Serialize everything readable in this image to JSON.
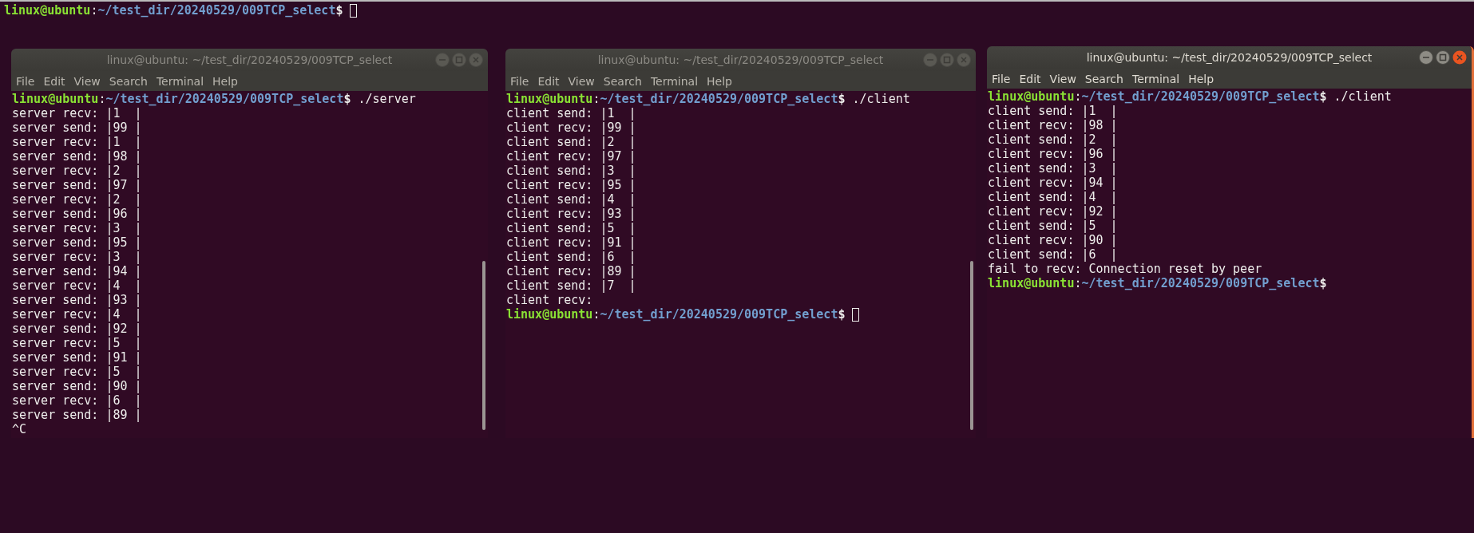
{
  "desktop_prompt": {
    "user": "linux@ubuntu",
    "separator": ":",
    "path": "~/test_dir/20240529/009TCP_select",
    "symbol": "$",
    "cursor": true
  },
  "windows": [
    {
      "title": "linux@ubuntu: ~/test_dir/20240529/009TCP_select",
      "focused": false,
      "menu": [
        "File",
        "Edit",
        "View",
        "Search",
        "Terminal",
        "Help"
      ],
      "lines": [
        {
          "kind": "prompt",
          "user": "linux@ubuntu",
          "separator": ":",
          "path": "~/test_dir/20240529/009TCP_select",
          "symbol": "$",
          "command": " ./server"
        },
        {
          "kind": "output",
          "text": "server recv: |1  |"
        },
        {
          "kind": "output",
          "text": "server send: |99 |"
        },
        {
          "kind": "output",
          "text": "server recv: |1  |"
        },
        {
          "kind": "output",
          "text": "server send: |98 |"
        },
        {
          "kind": "output",
          "text": "server recv: |2  |"
        },
        {
          "kind": "output",
          "text": "server send: |97 |"
        },
        {
          "kind": "output",
          "text": "server recv: |2  |"
        },
        {
          "kind": "output",
          "text": "server send: |96 |"
        },
        {
          "kind": "output",
          "text": "server recv: |3  |"
        },
        {
          "kind": "output",
          "text": "server send: |95 |"
        },
        {
          "kind": "output",
          "text": "server recv: |3  |"
        },
        {
          "kind": "output",
          "text": "server send: |94 |"
        },
        {
          "kind": "output",
          "text": "server recv: |4  |"
        },
        {
          "kind": "output",
          "text": "server send: |93 |"
        },
        {
          "kind": "output",
          "text": "server recv: |4  |"
        },
        {
          "kind": "output",
          "text": "server send: |92 |"
        },
        {
          "kind": "output",
          "text": "server recv: |5  |"
        },
        {
          "kind": "output",
          "text": "server send: |91 |"
        },
        {
          "kind": "output",
          "text": "server recv: |5  |"
        },
        {
          "kind": "output",
          "text": "server send: |90 |"
        },
        {
          "kind": "output",
          "text": "server recv: |6  |"
        },
        {
          "kind": "output",
          "text": "server send: |89 |"
        },
        {
          "kind": "output",
          "text": "^C"
        }
      ]
    },
    {
      "title": "linux@ubuntu: ~/test_dir/20240529/009TCP_select",
      "focused": false,
      "menu": [
        "File",
        "Edit",
        "View",
        "Search",
        "Terminal",
        "Help"
      ],
      "lines": [
        {
          "kind": "prompt",
          "user": "linux@ubuntu",
          "separator": ":",
          "path": "~/test_dir/20240529/009TCP_select",
          "symbol": "$",
          "command": " ./client"
        },
        {
          "kind": "output",
          "text": "client send: |1  |"
        },
        {
          "kind": "output",
          "text": "client recv: |99 |"
        },
        {
          "kind": "output",
          "text": "client send: |2  |"
        },
        {
          "kind": "output",
          "text": "client recv: |97 |"
        },
        {
          "kind": "output",
          "text": "client send: |3  |"
        },
        {
          "kind": "output",
          "text": "client recv: |95 |"
        },
        {
          "kind": "output",
          "text": "client send: |4  |"
        },
        {
          "kind": "output",
          "text": "client recv: |93 |"
        },
        {
          "kind": "output",
          "text": "client send: |5  |"
        },
        {
          "kind": "output",
          "text": "client recv: |91 |"
        },
        {
          "kind": "output",
          "text": "client send: |6  |"
        },
        {
          "kind": "output",
          "text": "client recv: |89 |"
        },
        {
          "kind": "output",
          "text": "client send: |7  |"
        },
        {
          "kind": "output",
          "text": "client recv:"
        },
        {
          "kind": "prompt",
          "user": "linux@ubuntu",
          "separator": ":",
          "path": "~/test_dir/20240529/009TCP_select",
          "symbol": "$",
          "cursor": true
        }
      ]
    },
    {
      "title": "linux@ubuntu: ~/test_dir/20240529/009TCP_select",
      "focused": true,
      "menu": [
        "File",
        "Edit",
        "View",
        "Search",
        "Terminal",
        "Help"
      ],
      "lines": [
        {
          "kind": "prompt",
          "user": "linux@ubuntu",
          "separator": ":",
          "path": "~/test_dir/20240529/009TCP_select",
          "symbol": "$",
          "command": " ./client"
        },
        {
          "kind": "output",
          "text": "client send: |1  |"
        },
        {
          "kind": "output",
          "text": "client recv: |98 |"
        },
        {
          "kind": "output",
          "text": "client send: |2  |"
        },
        {
          "kind": "output",
          "text": "client recv: |96 |"
        },
        {
          "kind": "output",
          "text": "client send: |3  |"
        },
        {
          "kind": "output",
          "text": "client recv: |94 |"
        },
        {
          "kind": "output",
          "text": "client send: |4  |"
        },
        {
          "kind": "output",
          "text": "client recv: |92 |"
        },
        {
          "kind": "output",
          "text": "client send: |5  |"
        },
        {
          "kind": "output",
          "text": "client recv: |90 |"
        },
        {
          "kind": "output",
          "text": "client send: |6  |"
        },
        {
          "kind": "output",
          "text": "fail to recv: Connection reset by peer"
        },
        {
          "kind": "prompt",
          "user": "linux@ubuntu",
          "separator": ":",
          "path": "~/test_dir/20240529/009TCP_select",
          "symbol": "$"
        }
      ]
    }
  ]
}
